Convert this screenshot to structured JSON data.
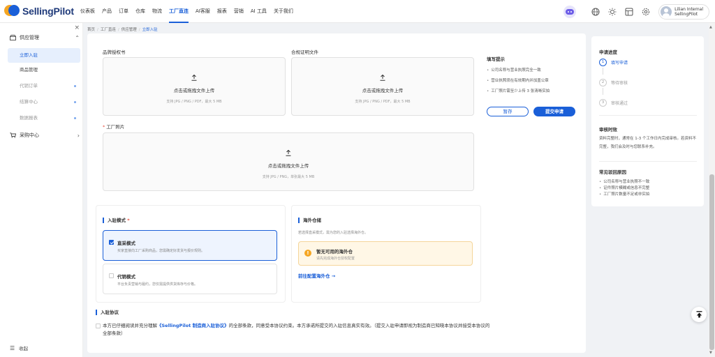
{
  "app": {
    "name": "SellingPilot"
  },
  "nav": [
    "仪表板",
    "产品",
    "订单",
    "仓库",
    "物流",
    "工厂直连",
    "AI客服",
    "报表",
    "营销",
    "AI 工具",
    "关于我们"
  ],
  "nav_active_index": 5,
  "user": {
    "name_line1": "Lilian Internal",
    "name_line2": "SellingPilot"
  },
  "sidebar": {
    "close": "×",
    "group1": "供应管理",
    "items": [
      {
        "label": "立即入驻",
        "state": "active"
      },
      {
        "label": "商品管理",
        "state": "normal"
      },
      {
        "label": "代销订单",
        "state": "muted"
      },
      {
        "label": "结算中心",
        "state": "muted"
      },
      {
        "label": "数据报表",
        "state": "muted"
      }
    ],
    "group2": "采购中心",
    "collapse": "收起"
  },
  "breadcrumb": [
    "首页",
    "工厂直连",
    "供应管理",
    "立即入驻"
  ],
  "uploads": {
    "brand_auth": {
      "label": "品牌授权书",
      "action": "点击或拖拽文件上传",
      "hint": "支持 JPG / PNG / PDF，最大 5 MB"
    },
    "compliance": {
      "label": "合规证明文件",
      "action": "点击或拖拽文件上传",
      "hint": "支持 JPG / PNG / PDF，最大 5 MB"
    },
    "factory_photos": {
      "label": "工厂照片",
      "required": "*",
      "action": "点击或拖拽文件上传",
      "hint": "支持 JPG / PNG，单张最大 5 MB"
    }
  },
  "tips": {
    "title": "填写提示",
    "items": [
      "公司名称与营业执照完全一致",
      "营业执照须在有效期内并加盖公章",
      "工厂照片需至少上传 3 张清晰实拍"
    ],
    "save": "暂存",
    "submit": "提交申请"
  },
  "mode": {
    "title": "入驻模式",
    "required": "*",
    "options": [
      {
        "title": "直采模式",
        "desc": "买家直接向工厂采购商品，您需确定好发货与报价规则。",
        "selected": true
      },
      {
        "title": "代销模式",
        "desc": "平台负责营销与履约，您仅需提供供货库存与价格。",
        "selected": false
      }
    ]
  },
  "overseas": {
    "title": "海外仓储",
    "desc": "若选择直采模式，需为您的入驻选择海外仓。",
    "warn_title": "暂无可用的海外仓",
    "warn_desc": "请先完成海外仓授权配置",
    "link": "前往配置海外仓 →"
  },
  "agreement": {
    "title": "入驻协议",
    "pre": "本方已仔细阅读并充分理解",
    "link": "《SellingPilot 制造商入驻协议》",
    "post": "的全部条款，同意受本协议约束。本方承诺所提交的入驻信息真实有效。（提交入驻申请即视为制造商已知晓本协议并接受本协议的全部条款）"
  },
  "progress": {
    "title": "申请进度",
    "steps": [
      {
        "num": "1",
        "label": "填写申请",
        "active": true
      },
      {
        "num": "2",
        "label": "等待审核",
        "active": false
      },
      {
        "num": "3",
        "label": "审核通过",
        "active": false
      }
    ],
    "timing_title": "审核时效",
    "timing_text": "资料完整时，通常在 1-3 个工作日内完成审核。若资料不完整，我们会及时与您联系补充。",
    "faq_title": "常见驳回原因",
    "faq": [
      "公司名称与营业执照不一致",
      "证件照片模糊或信息不完整",
      "工厂照片数量不足或非实拍"
    ]
  },
  "colors": {
    "accent": "#1a5fd8",
    "warning": "#f5a623"
  }
}
